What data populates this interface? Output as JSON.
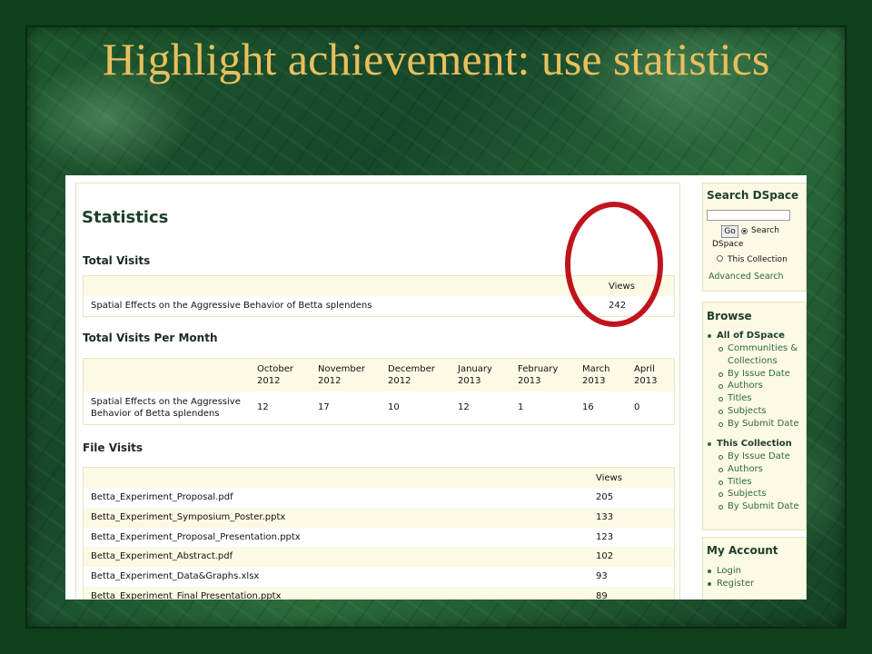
{
  "slide": {
    "title": "Highlight achievement: use statistics",
    "title_color": "#e8bf5e",
    "annotation_color": "#c0141d"
  },
  "stats": {
    "heading": "Statistics",
    "total_visits": {
      "heading": "Total Visits",
      "views_header": "Views",
      "item": "Spatial Effects on the Aggressive Behavior of Betta splendens",
      "views": "242"
    },
    "per_month": {
      "heading": "Total Visits Per Month",
      "months": [
        {
          "label": "October\n2012",
          "value": "12"
        },
        {
          "label": "November\n2012",
          "value": "17"
        },
        {
          "label": "December\n2012",
          "value": "10"
        },
        {
          "label": "January\n2013",
          "value": "12"
        },
        {
          "label": "February\n2013",
          "value": "1"
        },
        {
          "label": "March\n2013",
          "value": "16"
        },
        {
          "label": "April\n2013",
          "value": "0"
        }
      ],
      "item": "Spatial Effects on the Aggressive Behavior of Betta splendens"
    },
    "file_visits": {
      "heading": "File Visits",
      "views_header": "Views",
      "rows": [
        {
          "file": "Betta_Experiment_Proposal.pdf",
          "views": "205"
        },
        {
          "file": "Betta_Experiment_Symposium_Poster.pptx",
          "views": "133"
        },
        {
          "file": "Betta_Experiment_Proposal_Presentation.pptx",
          "views": "123"
        },
        {
          "file": "Betta_Experiment_Abstract.pdf",
          "views": "102"
        },
        {
          "file": "Betta_Experiment_Data&Graphs.xlsx",
          "views": "93"
        },
        {
          "file": "Betta_Experiment_Final Presentation.pptx",
          "views": "89"
        }
      ]
    }
  },
  "sidebar": {
    "search": {
      "title": "Search DSpace",
      "go_label": "Go",
      "radio_search": "Search",
      "radio_search_line2": "DSpace",
      "radio_collection": "This Collection",
      "advanced": "Advanced Search"
    },
    "browse": {
      "title": "Browse",
      "all_heading": "All of DSpace",
      "all_items": [
        "Communities &",
        "Collections",
        "By Issue Date",
        "Authors",
        "Titles",
        "Subjects",
        "By Submit Date"
      ],
      "coll_heading": "This Collection",
      "coll_items": [
        "By Issue Date",
        "Authors",
        "Titles",
        "Subjects",
        "By Submit Date"
      ]
    },
    "account": {
      "title": "My Account",
      "items": [
        "Login",
        "Register"
      ]
    }
  }
}
